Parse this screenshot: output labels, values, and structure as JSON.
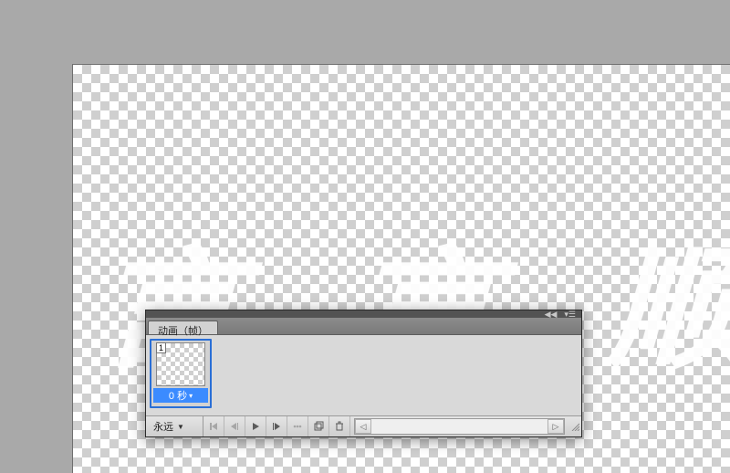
{
  "canvas": {
    "text_layer": "言 言 顺 衣"
  },
  "panel": {
    "collapse_glyph": "◀◀",
    "menu_glyph": "▾☰",
    "tab_label": "动画（帧）",
    "frames": [
      {
        "index": "1",
        "delay": "0 秒",
        "dropdown_glyph": "▾"
      }
    ],
    "loop": {
      "label": "永远",
      "dropdown_glyph": "▼"
    },
    "scroll": {
      "left_glyph": "◁",
      "right_glyph": "▷"
    }
  }
}
